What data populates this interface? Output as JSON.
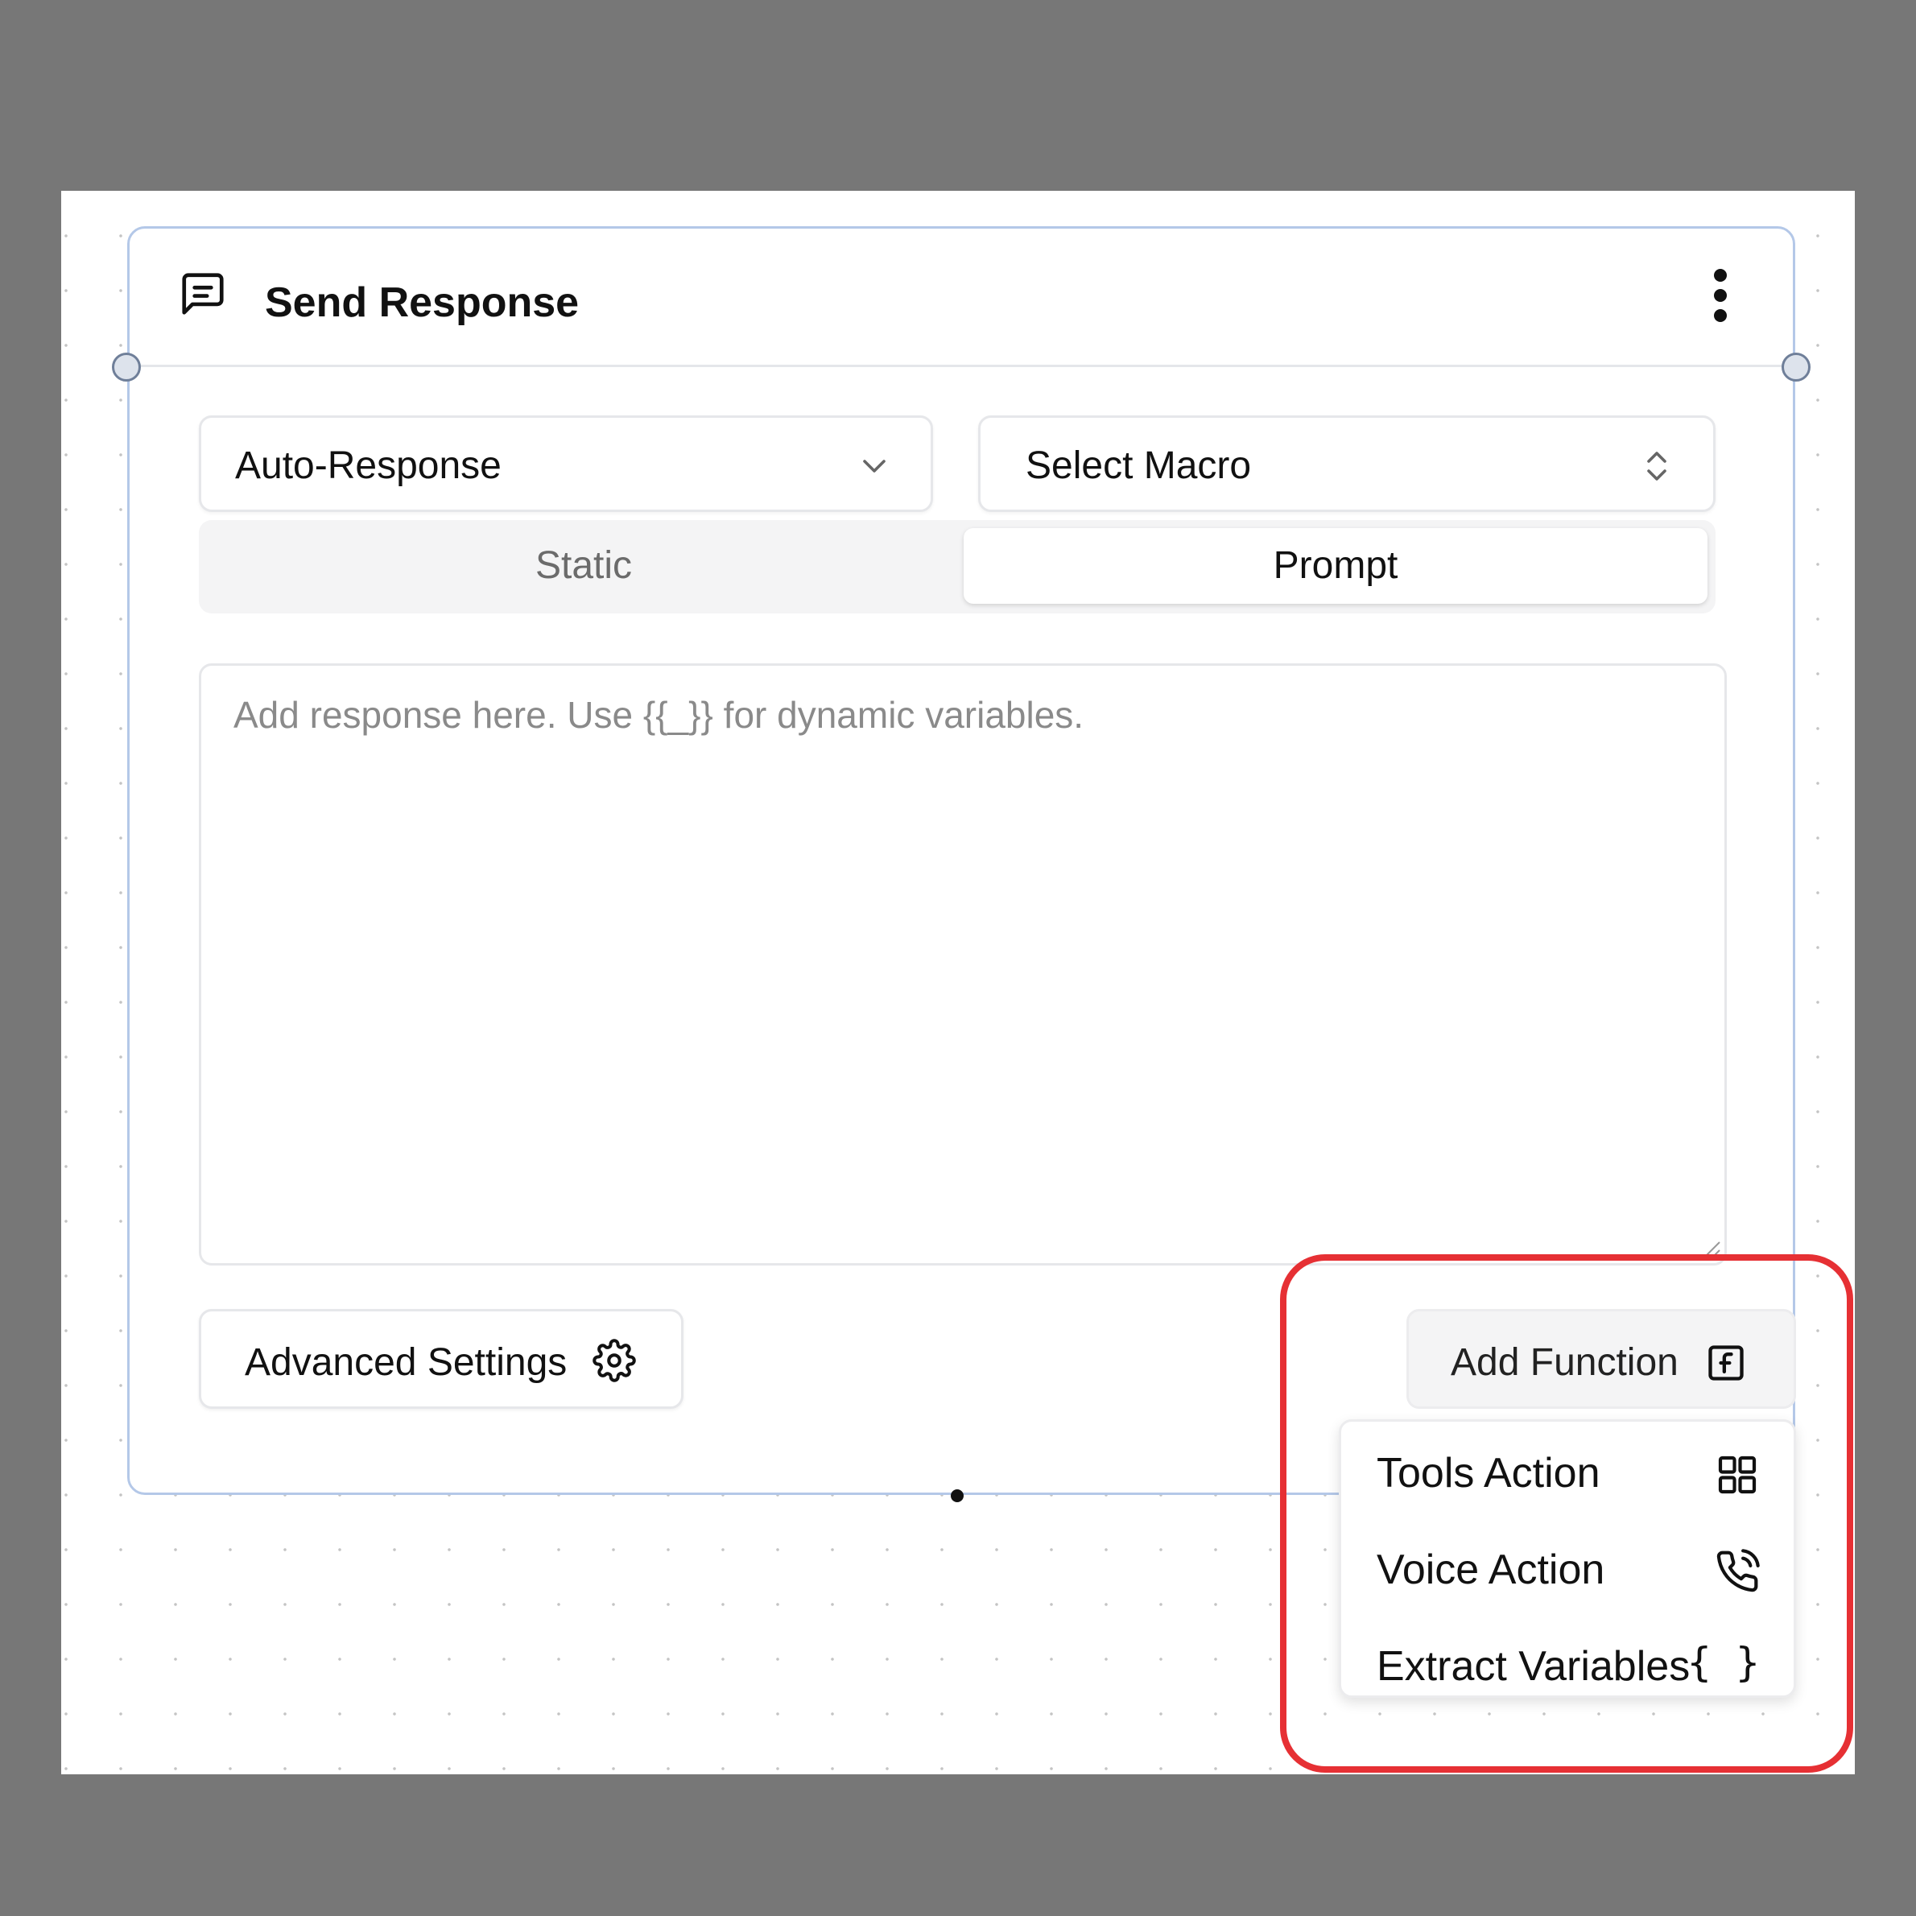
{
  "node": {
    "title": "Send Response",
    "title_icon": "message-square-icon",
    "menu_icon": "more-vertical-icon"
  },
  "response_type_select": {
    "value": "Auto-Response",
    "icon": "chevron-down-icon"
  },
  "macro_select": {
    "value": "Select Macro",
    "icon": "chevrons-up-down-icon"
  },
  "tabs": [
    {
      "label": "Static",
      "active": false
    },
    {
      "label": "Prompt",
      "active": true
    }
  ],
  "response_input": {
    "placeholder": "Add response here. Use {{_}} for dynamic variables.",
    "value": ""
  },
  "advanced_settings_button": {
    "label": "Advanced Settings",
    "icon": "gear-icon"
  },
  "add_function_button": {
    "label": "Add Function",
    "icon": "function-icon"
  },
  "function_menu": {
    "items": [
      {
        "label": "Tools Action",
        "icon": "grid-icon"
      },
      {
        "label": "Voice Action",
        "icon": "phone-call-icon"
      },
      {
        "label": "Extract Variables",
        "icon": "braces-icon",
        "icon_text": "{ }"
      }
    ]
  },
  "colors": {
    "page_background": "#777777",
    "node_border": "#b4c8e8",
    "highlight": "#e63034"
  }
}
